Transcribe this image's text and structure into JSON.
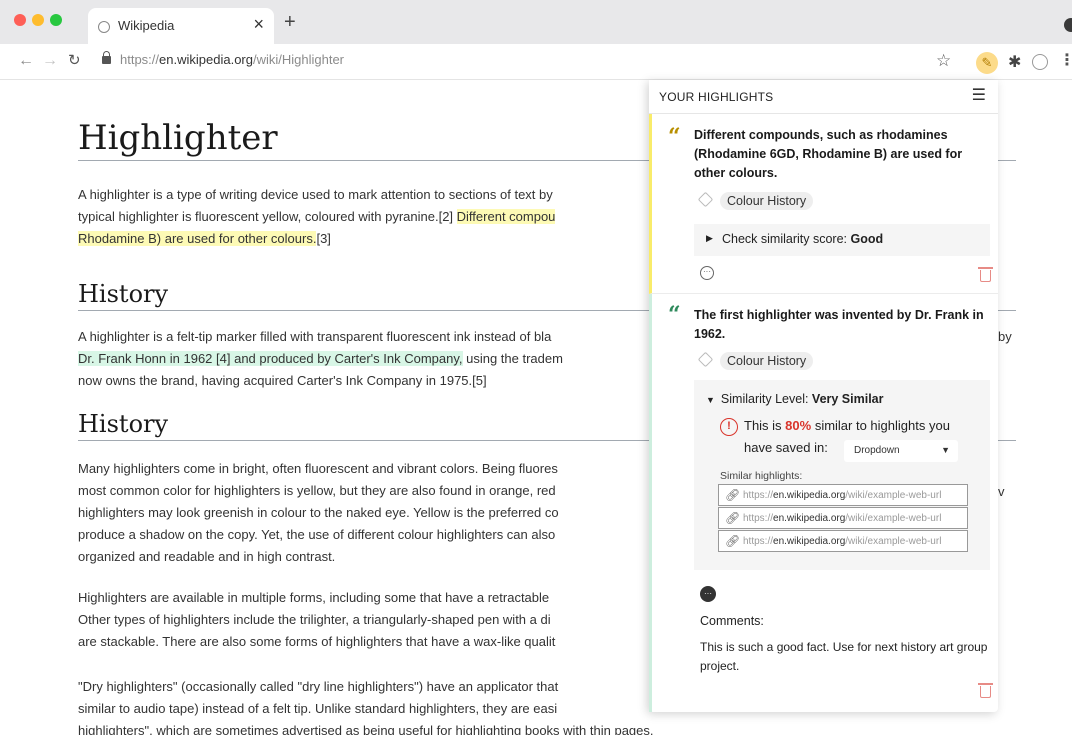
{
  "browser": {
    "tab_title": "Wikipedia",
    "tab_close": "×",
    "new_tab": "+",
    "url_scheme": "https://",
    "url_host": "en.wikipedia.org",
    "url_path": "/wiki/Highlighter",
    "icons": [
      "back-arrow-icon",
      "forward-arrow-icon",
      "reload-icon",
      "lock-icon",
      "star-icon",
      "highlighter-extension-icon",
      "puzzle-icon",
      "profile-icon",
      "kebab-menu-icon"
    ]
  },
  "article": {
    "title": "Highlighter",
    "intro": {
      "l1": "A highlighter is a type of writing device used to mark attention to sections of text by",
      "l2_plain": "typical highlighter is fluorescent yellow, coloured with pyranine.[2] ",
      "l2_hl": "Different compou",
      "l3_hl": "Rhodamine B) are used for other colours.",
      "l3_plain": "[3]"
    },
    "section1": {
      "heading": "History",
      "l1": "A highlighter is a felt-tip marker filled with transparent fluorescent ink instead of bla",
      "l2_hl": "Dr. Frank Honn in 1962 [4] and produced by Carter's Ink Company,",
      "l2_plain": " using the tradem",
      "l3": "now owns the brand, having acquired Carter's Ink Company in 1975.[5]",
      "right_fragment": "by"
    },
    "section2": {
      "heading": "History",
      "para1": [
        "Many highlighters come in bright, often fluorescent and vibrant colors. Being fluores",
        "most common color for highlighters is yellow, but they are also found in orange, red",
        "highlighters may look greenish in colour to the naked eye. Yellow is the preferred co",
        "produce a shadow on the copy. Yet, the use of different colour highlighters can also",
        "organized and readable and in high contrast."
      ],
      "para2": [
        "Highlighters are available in multiple forms, including some that have a retractable",
        "Other types of highlighters include the trilighter, a triangularly-shaped pen with a di",
        "are stackable. There are also some forms of highlighters that have a wax-like qualit"
      ],
      "para3": [
        "\"Dry highlighters\" (occasionally called \"dry line highlighters\") have an applicator that",
        "similar to audio tape) instead of a felt tip. Unlike standard highlighters, they are easi",
        "highlighters\", which are sometimes advertised as being useful for highlighting books with thin pages."
      ],
      "right_fragment": "v"
    }
  },
  "panel": {
    "title": "YOUR HIGHLIGHTS",
    "menu_icon": "hamburger-menu-icon",
    "quote_mark": "“",
    "cards": [
      {
        "color": "#f9ec6a",
        "text": "Different compounds, such as rhodamines (Rhodamine 6GD, Rhodamine B) are used for other colours.",
        "tag": "Colour History",
        "similarity_prefix": "Check similarity score: ",
        "similarity_value": "Good"
      },
      {
        "color": "#cdeede",
        "text": "The first highlighter was invented by Dr. Frank in 1962.",
        "tag": "Colour History",
        "similarity_prefix": "Similarity Level: ",
        "similarity_value": "Very Similar",
        "pct_prefix": "This is ",
        "pct": "80%",
        "pct_suffix": " similar to highlights you",
        "saved_in": "have saved in:",
        "dropdown": "Dropdown",
        "similar_label": "Similar highlights:",
        "links": [
          {
            "scheme": "https://",
            "host": "en.wikipedia.org",
            "path": "/wiki/example-web-url"
          },
          {
            "scheme": "https://",
            "host": "en.wikipedia.org",
            "path": "/wiki/example-web-url"
          },
          {
            "scheme": "https://",
            "host": "en.wikipedia.org",
            "path": "/wiki/example-web-url"
          }
        ],
        "comments_label": "Comments:",
        "comments_text": "This is such a good fact. Use for next history art group project."
      }
    ]
  }
}
